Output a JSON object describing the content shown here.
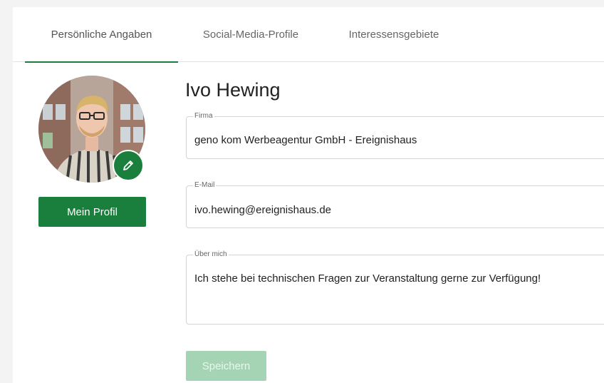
{
  "tabs": [
    {
      "label": "Persönliche Angaben",
      "active": true
    },
    {
      "label": "Social-Media-Profile",
      "active": false
    },
    {
      "label": "Interessensgebiete",
      "active": false
    }
  ],
  "profile": {
    "name": "Ivo Hewing",
    "avatar_icon": "user-photo",
    "edit_icon": "pencil-icon",
    "profile_button_label": "Mein Profil"
  },
  "fields": {
    "firma": {
      "label": "Firma",
      "value": "geno kom Werbeagentur GmbH - Ereignishaus"
    },
    "email": {
      "label": "E-Mail",
      "value": "ivo.hewing@ereignishaus.de"
    },
    "about": {
      "label": "Über mich",
      "value": "Ich stehe bei technischen Fragen zur Veranstaltung gerne zur Verfügung!"
    }
  },
  "actions": {
    "save_label": "Speichern",
    "save_disabled": true
  },
  "colors": {
    "accent": "#1a7f3c",
    "save_disabled_bg": "#a5d4b4"
  }
}
